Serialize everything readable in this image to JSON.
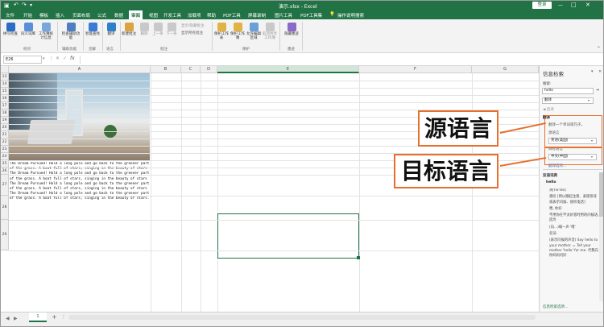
{
  "titlebar": {
    "doc_title": "演示.xlsx  -  Excel",
    "login": "登录",
    "autosave_icon": "save-icon",
    "undo_icon": "undo-icon",
    "redo_icon": "redo-icon",
    "customize_icon": "customize-icon"
  },
  "menu": {
    "tabs": [
      "文件",
      "开始",
      "模板",
      "插入",
      "页面布局",
      "公式",
      "数据",
      "审阅",
      "视图",
      "开发工具",
      "加载项",
      "帮助",
      "PDF工具",
      "屏幕录制",
      "图片工具",
      "PDF工具集"
    ],
    "active_tab": "审阅",
    "tell_me": "操作说明搜索"
  },
  "ribbon": {
    "buttons": [
      {
        "label": "拼写检查",
        "icon": "spellcheck-icon"
      },
      {
        "label": "同义词库",
        "icon": "thesaurus-icon"
      },
      {
        "label": "工作簿统计信息",
        "icon": "stats-icon"
      },
      {
        "label": "检查辅助功能",
        "icon": "accessibility-icon"
      },
      {
        "label": "智能查找",
        "icon": "smart-lookup-icon"
      },
      {
        "label": "翻译",
        "icon": "translate-icon"
      },
      {
        "label": "新建批注",
        "icon": "new-comment-icon"
      },
      {
        "label": "删除",
        "icon": "delete-comment-icon"
      },
      {
        "label": "上一条",
        "icon": "prev-comment-icon"
      },
      {
        "label": "下一条",
        "icon": "next-comment-icon"
      },
      {
        "label": "保护工作表",
        "icon": "protect-sheet-icon"
      },
      {
        "label": "保护工作簿",
        "icon": "protect-workbook-icon"
      },
      {
        "label": "允许编辑区域",
        "icon": "allow-edit-icon"
      },
      {
        "label": "取消共享工作簿",
        "icon": "unshare-icon"
      },
      {
        "label": "隐藏墨迹",
        "icon": "hide-ink-icon"
      }
    ],
    "comment_options": [
      "显示/隐藏批注",
      "显示所有批注"
    ],
    "groups": [
      "校对",
      "辅助功能",
      "见解",
      "语言",
      "批注",
      "保护",
      "墨迹"
    ]
  },
  "formula": {
    "cell_ref": "E26",
    "value": ""
  },
  "grid": {
    "columns": [
      "A",
      "B",
      "C",
      "D",
      "E",
      "F",
      "G"
    ],
    "rows": [
      "13",
      "14",
      "15",
      "16",
      "17",
      "18",
      "19",
      "20",
      "21",
      "22",
      "23",
      "24",
      "25",
      "26",
      "27",
      "28",
      "29"
    ],
    "cell_text": "The Dream Pursued! Hold a long pole and go back to the greener part of the grass. A boat full of stars, singing in the beauty of stars The Dream Pursued! Hold a long pole and go back to the greener part of the grass. A boat full of stars, singing in the beauty of stars The Dream Pursued! Hold a long pole and go back to the greener part of the grass. A boat full of stars, singing in the beauty of stars The Dream Pursued! Hold a long pole and go back to the greener part of the grass. A boat full of stars, singing in the beauty of stars."
  },
  "panel": {
    "title": "信息检索",
    "search_label": "搜索:",
    "search_value": "hello",
    "source_value": "翻译",
    "back_label": "◀ 后退",
    "section_translate": "翻译",
    "translate_hint": "翻译一个单词或句子。",
    "from_label": "源语言",
    "from_value": "英语(美国)",
    "to_label": "目标语言",
    "to_value": "中文(中国)",
    "options_link": "翻译选项...",
    "dict_header": "双语词典",
    "entry_word": "hello",
    "entry_lines": [
      "英[hə'ləʊ]",
      "感叹 [用以跟起注意、表现惊讶或表示问候、接听电话]",
      "喂, 你好",
      "不用你在不太好客时用的问候语, 因为",
      "(向...)喊一声 '喂'",
      "名词",
      "(表示问候的声音) Say hello to your mother. = Tell your mother 'hello' for me. 代我向你妈妈问好"
    ],
    "footer_link": "信息检索选项..."
  },
  "status": {
    "sheet_name": "1",
    "add_sheet": "+"
  },
  "callouts": {
    "source": "源语言",
    "target": "目标语言"
  },
  "colors": {
    "excel_green": "#217346",
    "callout_orange": "#e76f2e"
  }
}
